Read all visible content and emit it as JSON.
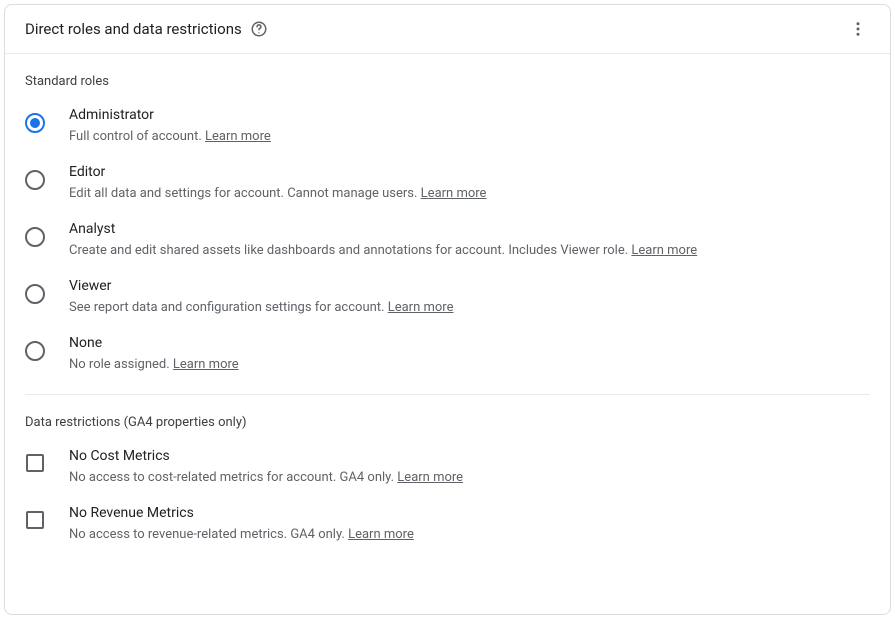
{
  "header": {
    "title": "Direct roles and data restrictions"
  },
  "sections": {
    "roles": {
      "label": "Standard roles"
    },
    "restrictions": {
      "label": "Data restrictions (GA4 properties only)"
    }
  },
  "roles": [
    {
      "title": "Administrator",
      "desc": "Full control of account. ",
      "learn": "Learn more",
      "selected": true
    },
    {
      "title": "Editor",
      "desc": "Edit all data and settings for account. Cannot manage users. ",
      "learn": "Learn more",
      "selected": false
    },
    {
      "title": "Analyst",
      "desc": "Create and edit shared assets like dashboards and annotations for account. Includes Viewer role. ",
      "learn": "Learn more",
      "selected": false
    },
    {
      "title": "Viewer",
      "desc": "See report data and configuration settings for account. ",
      "learn": "Learn more",
      "selected": false
    },
    {
      "title": "None",
      "desc": "No role assigned. ",
      "learn": "Learn more",
      "selected": false
    }
  ],
  "restrictions": [
    {
      "title": "No Cost Metrics",
      "desc": "No access to cost-related metrics for account. GA4 only. ",
      "learn": "Learn more"
    },
    {
      "title": "No Revenue Metrics",
      "desc": "No access to revenue-related metrics. GA4 only. ",
      "learn": "Learn more"
    }
  ]
}
